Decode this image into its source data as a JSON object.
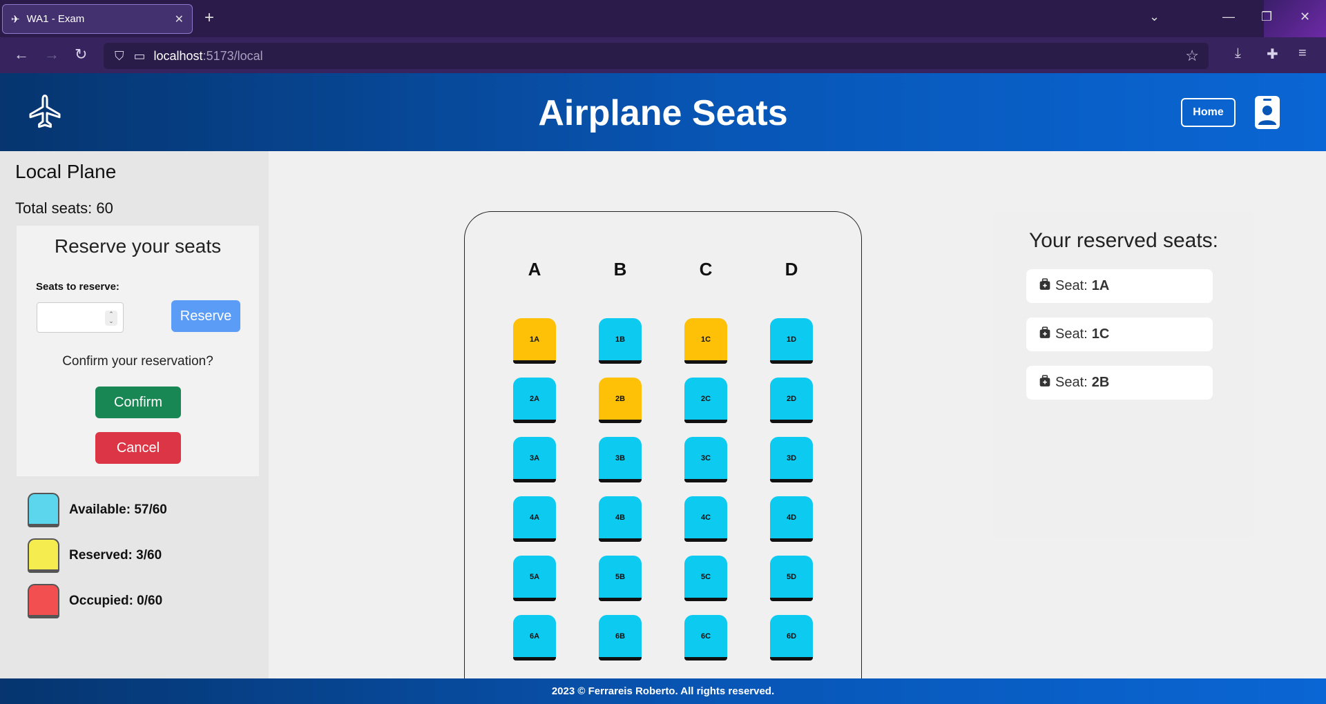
{
  "browser": {
    "tab_title": "WA1 - Exam",
    "url_host": "localhost",
    "url_path": ":5173/local"
  },
  "header": {
    "title": "Airplane Seats",
    "home_label": "Home"
  },
  "sidebar": {
    "plane_name": "Local Plane",
    "total_seats": "Total seats: 60",
    "reserve_title": "Reserve your seats",
    "seats_label": "Seats to reserve:",
    "seats_value": "",
    "reserve_label": "Reserve",
    "confirm_question": "Confirm your reservation?",
    "confirm_label": "Confirm",
    "cancel_label": "Cancel",
    "legend": [
      {
        "label": "Available: 57/60",
        "color": "#5bd6ec"
      },
      {
        "label": "Reserved: 3/60",
        "color": "#f5ec4f"
      },
      {
        "label": "Occupied: 0/60",
        "color": "#f25050"
      }
    ]
  },
  "seatmap": {
    "columns": [
      "A",
      "B",
      "C",
      "D"
    ],
    "rows": [
      [
        {
          "id": "1A",
          "status": "reserved"
        },
        {
          "id": "1B",
          "status": "available"
        },
        {
          "id": "1C",
          "status": "reserved"
        },
        {
          "id": "1D",
          "status": "available"
        }
      ],
      [
        {
          "id": "2A",
          "status": "available"
        },
        {
          "id": "2B",
          "status": "reserved"
        },
        {
          "id": "2C",
          "status": "available"
        },
        {
          "id": "2D",
          "status": "available"
        }
      ],
      [
        {
          "id": "3A",
          "status": "available"
        },
        {
          "id": "3B",
          "status": "available"
        },
        {
          "id": "3C",
          "status": "available"
        },
        {
          "id": "3D",
          "status": "available"
        }
      ],
      [
        {
          "id": "4A",
          "status": "available"
        },
        {
          "id": "4B",
          "status": "available"
        },
        {
          "id": "4C",
          "status": "available"
        },
        {
          "id": "4D",
          "status": "available"
        }
      ],
      [
        {
          "id": "5A",
          "status": "available"
        },
        {
          "id": "5B",
          "status": "available"
        },
        {
          "id": "5C",
          "status": "available"
        },
        {
          "id": "5D",
          "status": "available"
        }
      ],
      [
        {
          "id": "6A",
          "status": "available"
        },
        {
          "id": "6B",
          "status": "available"
        },
        {
          "id": "6C",
          "status": "available"
        },
        {
          "id": "6D",
          "status": "available"
        }
      ]
    ],
    "colors": {
      "available": "#0dcaf0",
      "reserved": "#ffc107"
    }
  },
  "reserved_panel": {
    "title": "Your reserved seats:",
    "prefix": "Seat:",
    "seats": [
      "1A",
      "1C",
      "2B"
    ]
  },
  "footer": {
    "text": "2023 © Ferrareis Roberto. All rights reserved."
  }
}
